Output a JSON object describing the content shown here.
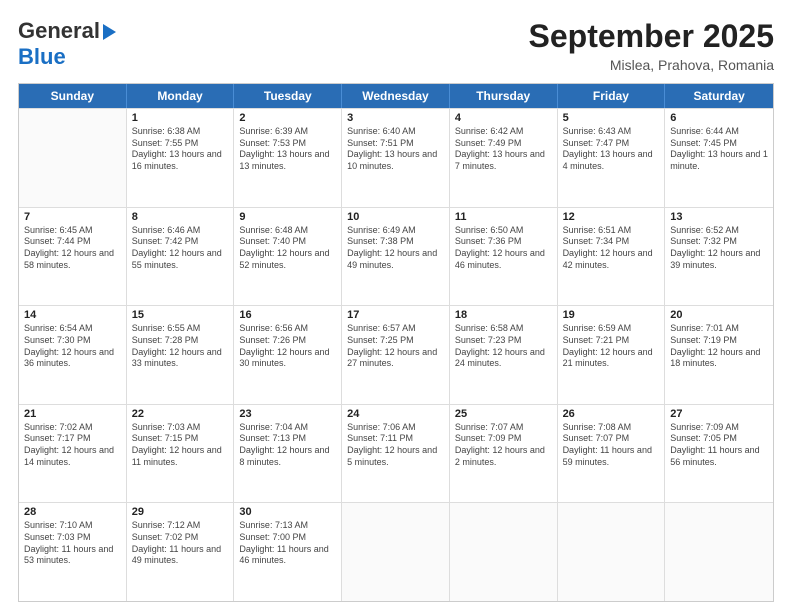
{
  "header": {
    "logo_line1": "General",
    "logo_line2": "Blue",
    "month_year": "September 2025",
    "location": "Mislea, Prahova, Romania"
  },
  "days_of_week": [
    "Sunday",
    "Monday",
    "Tuesday",
    "Wednesday",
    "Thursday",
    "Friday",
    "Saturday"
  ],
  "weeks": [
    [
      {
        "day": "",
        "sunrise": "",
        "sunset": "",
        "daylight": ""
      },
      {
        "day": "1",
        "sunrise": "Sunrise: 6:38 AM",
        "sunset": "Sunset: 7:55 PM",
        "daylight": "Daylight: 13 hours and 16 minutes."
      },
      {
        "day": "2",
        "sunrise": "Sunrise: 6:39 AM",
        "sunset": "Sunset: 7:53 PM",
        "daylight": "Daylight: 13 hours and 13 minutes."
      },
      {
        "day": "3",
        "sunrise": "Sunrise: 6:40 AM",
        "sunset": "Sunset: 7:51 PM",
        "daylight": "Daylight: 13 hours and 10 minutes."
      },
      {
        "day": "4",
        "sunrise": "Sunrise: 6:42 AM",
        "sunset": "Sunset: 7:49 PM",
        "daylight": "Daylight: 13 hours and 7 minutes."
      },
      {
        "day": "5",
        "sunrise": "Sunrise: 6:43 AM",
        "sunset": "Sunset: 7:47 PM",
        "daylight": "Daylight: 13 hours and 4 minutes."
      },
      {
        "day": "6",
        "sunrise": "Sunrise: 6:44 AM",
        "sunset": "Sunset: 7:45 PM",
        "daylight": "Daylight: 13 hours and 1 minute."
      }
    ],
    [
      {
        "day": "7",
        "sunrise": "Sunrise: 6:45 AM",
        "sunset": "Sunset: 7:44 PM",
        "daylight": "Daylight: 12 hours and 58 minutes."
      },
      {
        "day": "8",
        "sunrise": "Sunrise: 6:46 AM",
        "sunset": "Sunset: 7:42 PM",
        "daylight": "Daylight: 12 hours and 55 minutes."
      },
      {
        "day": "9",
        "sunrise": "Sunrise: 6:48 AM",
        "sunset": "Sunset: 7:40 PM",
        "daylight": "Daylight: 12 hours and 52 minutes."
      },
      {
        "day": "10",
        "sunrise": "Sunrise: 6:49 AM",
        "sunset": "Sunset: 7:38 PM",
        "daylight": "Daylight: 12 hours and 49 minutes."
      },
      {
        "day": "11",
        "sunrise": "Sunrise: 6:50 AM",
        "sunset": "Sunset: 7:36 PM",
        "daylight": "Daylight: 12 hours and 46 minutes."
      },
      {
        "day": "12",
        "sunrise": "Sunrise: 6:51 AM",
        "sunset": "Sunset: 7:34 PM",
        "daylight": "Daylight: 12 hours and 42 minutes."
      },
      {
        "day": "13",
        "sunrise": "Sunrise: 6:52 AM",
        "sunset": "Sunset: 7:32 PM",
        "daylight": "Daylight: 12 hours and 39 minutes."
      }
    ],
    [
      {
        "day": "14",
        "sunrise": "Sunrise: 6:54 AM",
        "sunset": "Sunset: 7:30 PM",
        "daylight": "Daylight: 12 hours and 36 minutes."
      },
      {
        "day": "15",
        "sunrise": "Sunrise: 6:55 AM",
        "sunset": "Sunset: 7:28 PM",
        "daylight": "Daylight: 12 hours and 33 minutes."
      },
      {
        "day": "16",
        "sunrise": "Sunrise: 6:56 AM",
        "sunset": "Sunset: 7:26 PM",
        "daylight": "Daylight: 12 hours and 30 minutes."
      },
      {
        "day": "17",
        "sunrise": "Sunrise: 6:57 AM",
        "sunset": "Sunset: 7:25 PM",
        "daylight": "Daylight: 12 hours and 27 minutes."
      },
      {
        "day": "18",
        "sunrise": "Sunrise: 6:58 AM",
        "sunset": "Sunset: 7:23 PM",
        "daylight": "Daylight: 12 hours and 24 minutes."
      },
      {
        "day": "19",
        "sunrise": "Sunrise: 6:59 AM",
        "sunset": "Sunset: 7:21 PM",
        "daylight": "Daylight: 12 hours and 21 minutes."
      },
      {
        "day": "20",
        "sunrise": "Sunrise: 7:01 AM",
        "sunset": "Sunset: 7:19 PM",
        "daylight": "Daylight: 12 hours and 18 minutes."
      }
    ],
    [
      {
        "day": "21",
        "sunrise": "Sunrise: 7:02 AM",
        "sunset": "Sunset: 7:17 PM",
        "daylight": "Daylight: 12 hours and 14 minutes."
      },
      {
        "day": "22",
        "sunrise": "Sunrise: 7:03 AM",
        "sunset": "Sunset: 7:15 PM",
        "daylight": "Daylight: 12 hours and 11 minutes."
      },
      {
        "day": "23",
        "sunrise": "Sunrise: 7:04 AM",
        "sunset": "Sunset: 7:13 PM",
        "daylight": "Daylight: 12 hours and 8 minutes."
      },
      {
        "day": "24",
        "sunrise": "Sunrise: 7:06 AM",
        "sunset": "Sunset: 7:11 PM",
        "daylight": "Daylight: 12 hours and 5 minutes."
      },
      {
        "day": "25",
        "sunrise": "Sunrise: 7:07 AM",
        "sunset": "Sunset: 7:09 PM",
        "daylight": "Daylight: 12 hours and 2 minutes."
      },
      {
        "day": "26",
        "sunrise": "Sunrise: 7:08 AM",
        "sunset": "Sunset: 7:07 PM",
        "daylight": "Daylight: 11 hours and 59 minutes."
      },
      {
        "day": "27",
        "sunrise": "Sunrise: 7:09 AM",
        "sunset": "Sunset: 7:05 PM",
        "daylight": "Daylight: 11 hours and 56 minutes."
      }
    ],
    [
      {
        "day": "28",
        "sunrise": "Sunrise: 7:10 AM",
        "sunset": "Sunset: 7:03 PM",
        "daylight": "Daylight: 11 hours and 53 minutes."
      },
      {
        "day": "29",
        "sunrise": "Sunrise: 7:12 AM",
        "sunset": "Sunset: 7:02 PM",
        "daylight": "Daylight: 11 hours and 49 minutes."
      },
      {
        "day": "30",
        "sunrise": "Sunrise: 7:13 AM",
        "sunset": "Sunset: 7:00 PM",
        "daylight": "Daylight: 11 hours and 46 minutes."
      },
      {
        "day": "",
        "sunrise": "",
        "sunset": "",
        "daylight": ""
      },
      {
        "day": "",
        "sunrise": "",
        "sunset": "",
        "daylight": ""
      },
      {
        "day": "",
        "sunrise": "",
        "sunset": "",
        "daylight": ""
      },
      {
        "day": "",
        "sunrise": "",
        "sunset": "",
        "daylight": ""
      }
    ]
  ]
}
